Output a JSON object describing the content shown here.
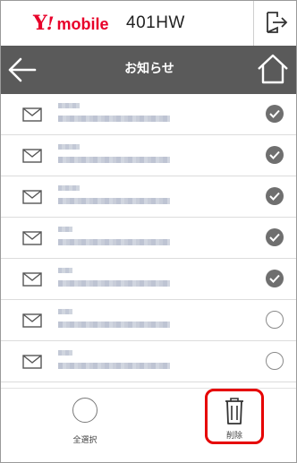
{
  "brand": {
    "name_mark": "Y",
    "name_bang": "!",
    "name_text": "mobile",
    "model": "401HW",
    "color": "#e8002a"
  },
  "header": {
    "title": "お知らせ",
    "background": "#5a5a5a"
  },
  "icons": {
    "logout": "logout-arrow-icon",
    "back": "back-arrow-icon",
    "home": "home-icon",
    "message": "envelope-icon",
    "check": "checkmark-circle-icon",
    "trash": "trash-icon"
  },
  "messages": [
    {
      "selected": true
    },
    {
      "selected": true
    },
    {
      "selected": true
    },
    {
      "selected": true
    },
    {
      "selected": true
    },
    {
      "selected": false
    },
    {
      "selected": false
    }
  ],
  "footer": {
    "select_all_label": "全選択",
    "delete_label": "削除",
    "highlight_color": "#e60000"
  }
}
